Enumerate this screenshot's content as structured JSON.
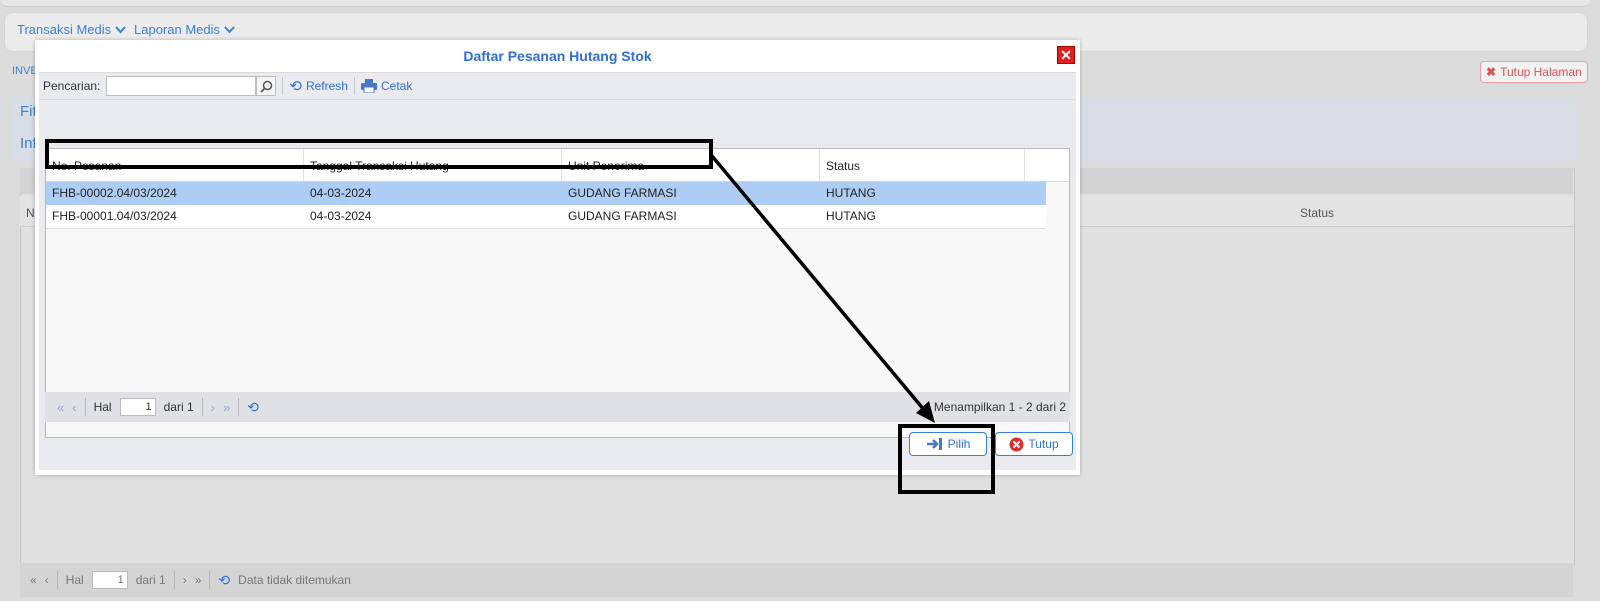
{
  "background": {
    "menu": [
      {
        "label": "Transaksi Medis"
      },
      {
        "label": "Laporan Medis"
      }
    ],
    "tab_label": "INVE",
    "close_page_label": "Tutup Halaman",
    "panel_text_1": "Fit",
    "panel_text_2": "Inf",
    "grid_col_first": "N",
    "grid_col_status": "Status",
    "pager": {
      "page_label": "Hal",
      "page_value": "1",
      "of_label": "dari 1",
      "empty_message": "Data tidak ditemukan"
    }
  },
  "dialog": {
    "title": "Daftar Pesanan Hutang Stok",
    "toolbar": {
      "search_label": "Pencarian:",
      "search_value": "",
      "refresh_label": "Refresh",
      "print_label": "Cetak"
    },
    "grid": {
      "columns": [
        "No. Pesanan",
        "Tanggal Transaksi Hutang",
        "Unit Penerima",
        "Status"
      ],
      "rows": [
        {
          "no": "FHB-00002.04/03/2024",
          "date": "04-03-2024",
          "unit": "GUDANG FARMASI",
          "status": "HUTANG",
          "selected": true
        },
        {
          "no": "FHB-00001.04/03/2024",
          "date": "04-03-2024",
          "unit": "GUDANG FARMASI",
          "status": "HUTANG",
          "selected": false
        }
      ]
    },
    "pager": {
      "page_label": "Hal",
      "page_value": "1",
      "of_label": "dari 1",
      "showing": "Menampilkan 1 - 2 dari 2"
    },
    "buttons": {
      "select_label": "Pilih",
      "close_label": "Tutup"
    }
  },
  "colors": {
    "accent": "#2f6fd6",
    "selected_row": "#aecdf5",
    "close_red": "#e02020"
  }
}
